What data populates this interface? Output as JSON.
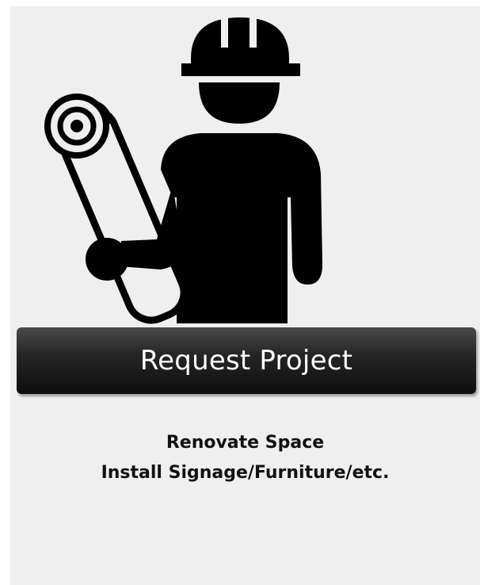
{
  "card": {
    "icon": "construction-worker-blueprint-icon",
    "button_label": "Request Project",
    "description_lines": [
      "Renovate Space",
      "Install Signage/Furniture/etc."
    ]
  },
  "colors": {
    "card_background": "#efefef",
    "button_background": "#1a1a1a",
    "button_text": "#ffffff",
    "description_text": "#111111"
  }
}
